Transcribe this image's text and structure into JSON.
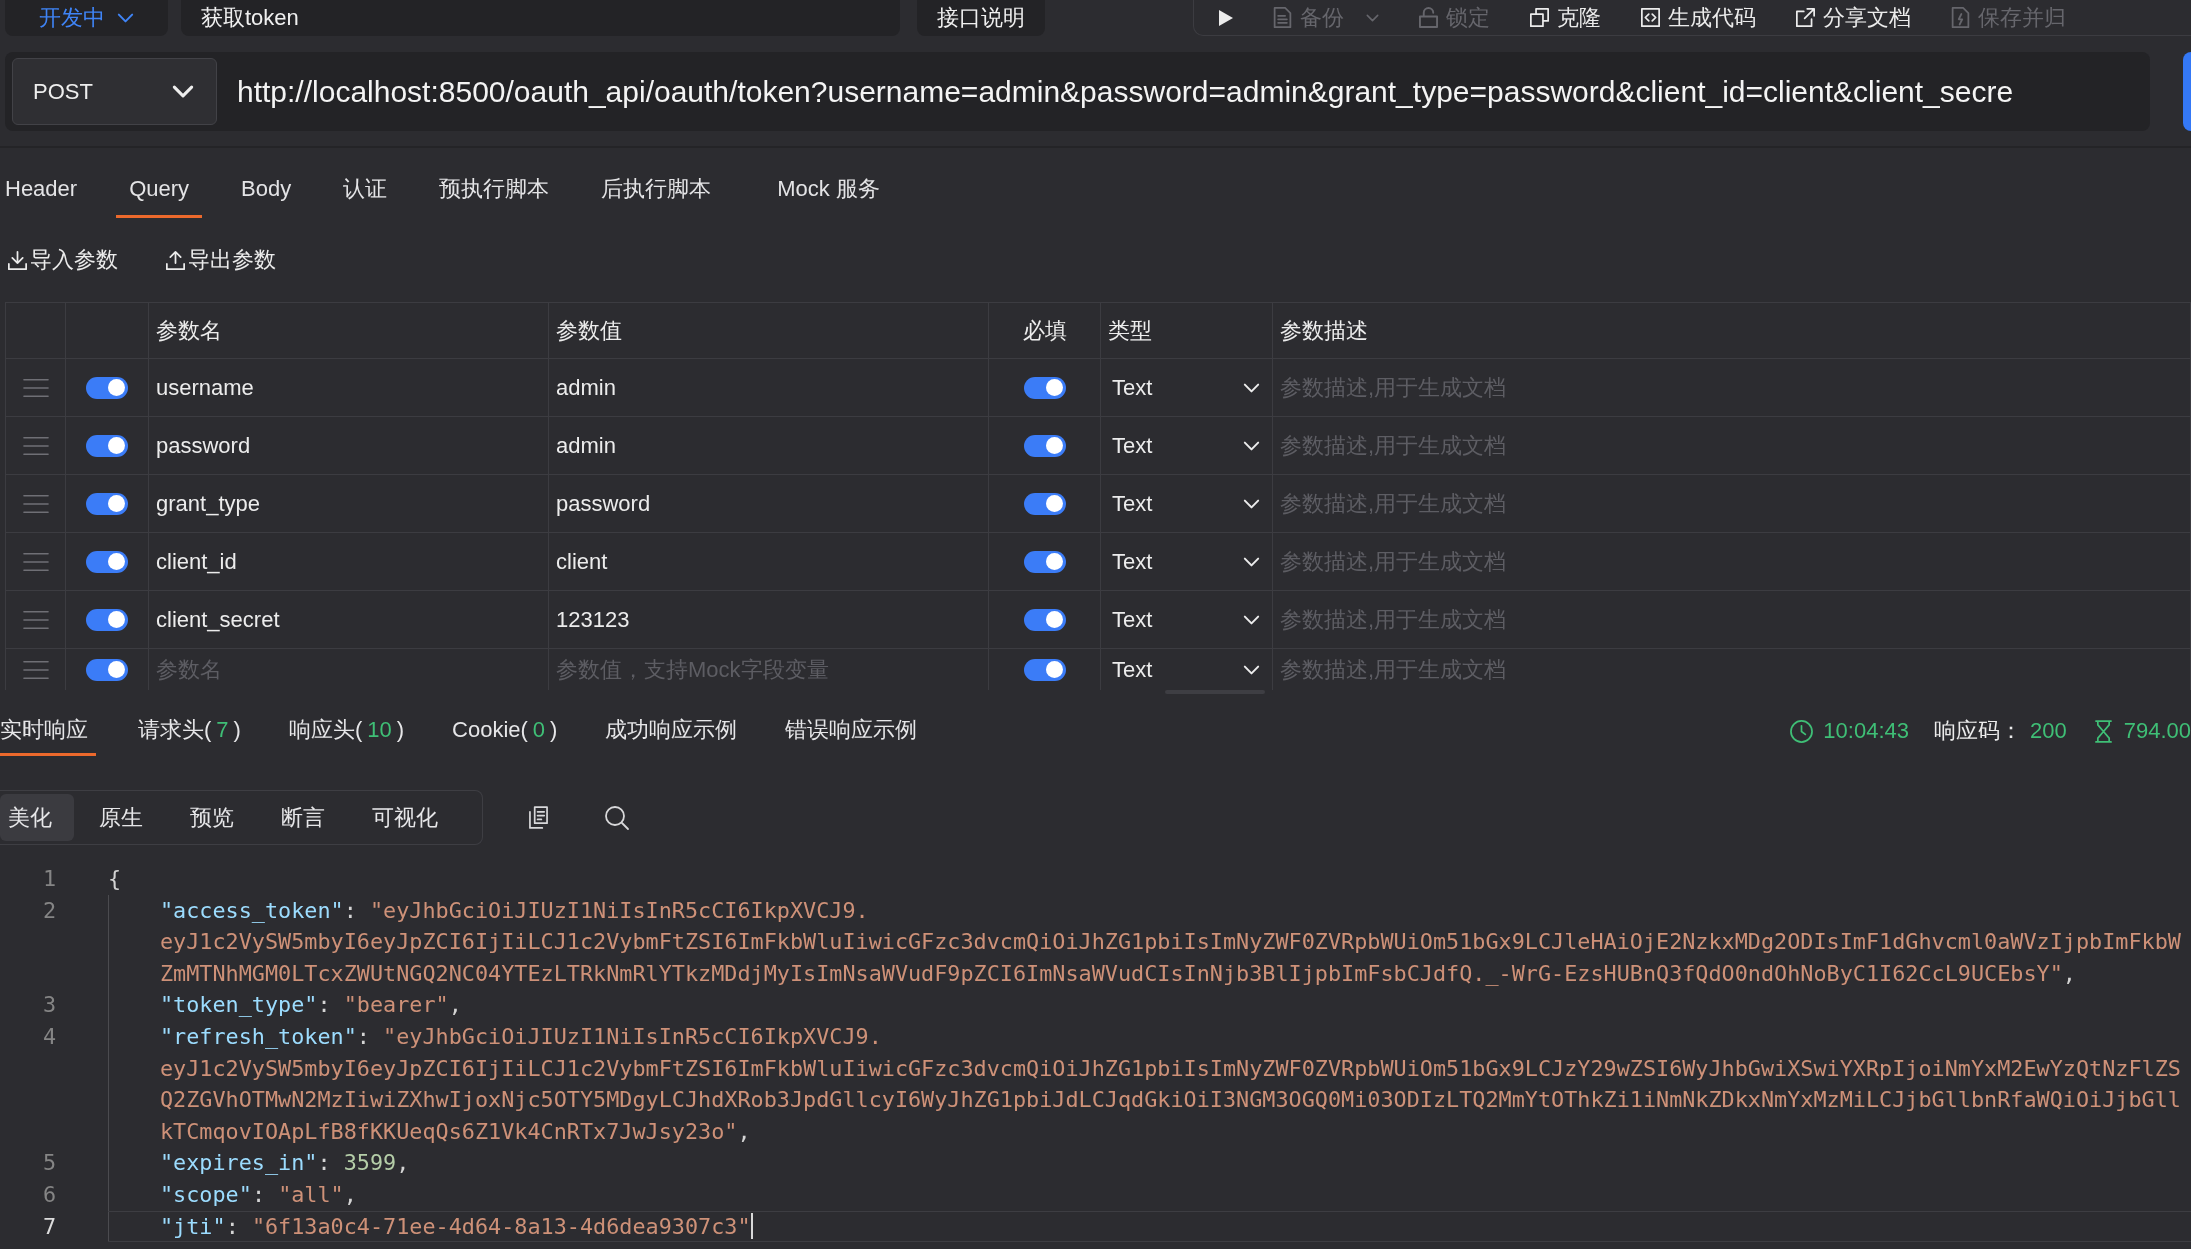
{
  "header": {
    "environment": "开发中",
    "api_name": "获取token",
    "doc_button": "接口说明",
    "toolbar": [
      {
        "kind": "icon",
        "disabled": false,
        "dropdown": false
      },
      {
        "kind": "text",
        "label": "备份",
        "disabled": true,
        "dropdown": true
      },
      {
        "kind": "text",
        "label": "锁定",
        "disabled": true,
        "dropdown": false
      },
      {
        "kind": "text",
        "label": "克隆",
        "disabled": false,
        "dropdown": false
      },
      {
        "kind": "text",
        "label": "生成代码",
        "disabled": false,
        "dropdown": false
      },
      {
        "kind": "text",
        "label": "分享文档",
        "disabled": false,
        "dropdown": false
      },
      {
        "kind": "text",
        "label": "保存并归",
        "disabled": true,
        "dropdown": false
      }
    ]
  },
  "request": {
    "method": "POST",
    "url": "http://localhost:8500/oauth_api/oauth/token?username=admin&password=admin&grant_type=password&client_id=client&client_secre"
  },
  "tabs": [
    {
      "label": "Header",
      "selected": false
    },
    {
      "label": "Query",
      "selected": true
    },
    {
      "label": "Body",
      "selected": false
    },
    {
      "label": "认证",
      "selected": false
    },
    {
      "label": "预执行脚本",
      "selected": false
    },
    {
      "label": "后执行脚本",
      "selected": false
    },
    {
      "label": "Mock 服务",
      "selected": false
    }
  ],
  "param_actions": [
    "导入参数",
    "导出参数"
  ],
  "params_table": {
    "columns": [
      "参数名",
      "参数值",
      "必填",
      "类型",
      "参数描述"
    ],
    "rows": [
      {
        "enabled": true,
        "name": {
          "text": "username"
        },
        "value": {
          "text": "admin"
        },
        "required": true,
        "type": "Text",
        "description": {
          "placeholder": "参数描述,用于生成文档"
        }
      },
      {
        "enabled": true,
        "name": {
          "text": "password"
        },
        "value": {
          "text": "admin"
        },
        "required": true,
        "type": "Text",
        "description": {
          "placeholder": "参数描述,用于生成文档"
        }
      },
      {
        "enabled": true,
        "name": {
          "text": "grant_type"
        },
        "value": {
          "text": "password"
        },
        "required": true,
        "type": "Text",
        "description": {
          "placeholder": "参数描述,用于生成文档"
        }
      },
      {
        "enabled": true,
        "name": {
          "text": "client_id"
        },
        "value": {
          "text": "client"
        },
        "required": true,
        "type": "Text",
        "description": {
          "placeholder": "参数描述,用于生成文档"
        }
      },
      {
        "enabled": true,
        "name": {
          "text": "client_secret"
        },
        "value": {
          "text": "123123"
        },
        "required": true,
        "type": "Text",
        "description": {
          "placeholder": "参数描述,用于生成文档"
        }
      },
      {
        "enabled": true,
        "name": {
          "placeholder": "参数名"
        },
        "value": {
          "placeholder": "参数值，支持Mock字段变量"
        },
        "required": true,
        "type": "Text",
        "description": {
          "placeholder": "参数描述,用于生成文档"
        }
      }
    ]
  },
  "response": {
    "tabs": [
      {
        "label": "实时响应",
        "selected": true
      },
      {
        "label": "请求头(",
        "count": "7",
        "label_end": ")",
        "selected": false
      },
      {
        "label": "响应头(",
        "count": "10",
        "label_end": ")",
        "selected": false
      },
      {
        "label": "Cookie(",
        "count": "0",
        "label_end": ")",
        "selected": false
      },
      {
        "label": "成功响应示例",
        "selected": false
      },
      {
        "label": "错误响应示例",
        "selected": false
      }
    ],
    "time": "10:04:43",
    "code_label": "响应码：",
    "code": "200",
    "duration": "794.00",
    "view_modes": [
      {
        "label": "美化",
        "selected": true
      },
      {
        "label": "原生",
        "selected": false
      },
      {
        "label": "预览",
        "selected": false
      },
      {
        "label": "断言",
        "selected": false
      },
      {
        "label": "可视化",
        "selected": false
      }
    ]
  },
  "code_editor": {
    "lines": [
      {
        "number": "1",
        "current": false,
        "wrapped_lines": [
          {
            "tokens": [
              {
                "kind": "punct",
                "text": "{"
              }
            ]
          }
        ],
        "children": [
          {
            "number": "2",
            "current": false,
            "wrapped_lines": [
              {
                "tokens": [
                  {
                    "kind": "key",
                    "text": "\"access_token\""
                  },
                  {
                    "kind": "punct",
                    "text": ": "
                  },
                  {
                    "kind": "string",
                    "text": "\"eyJhbGciOiJIUzI1NiIsInR5cCI6IkpXVCJ9."
                  }
                ]
              },
              {
                "tokens": [
                  {
                    "kind": "string",
                    "text": "eyJ1c2VySW5mbyI6eyJpZCI6IjIiLCJ1c2VybmFtZSI6ImFkbWluIiwicGFzc3dvcmQiOiJhZG1pbiIsImNyZWF0ZVRpbWUiOm51bGx9LCJleHAiOjE2NzkxMDg2ODIsImF1dGhvcml0aWVzIjpbImFkbW"
                  }
                ]
              },
              {
                "tokens": [
                  {
                    "kind": "string",
                    "text": "ZmMTNhMGM0LTcxZWUtNGQ2NC04YTEzLTRkNmRlYTkzMDdjMyIsImNsaWVudF9pZCI6ImNsaWVudCIsInNjb3BlIjpbImFsbCJdfQ._-WrG-EzsHUBnQ3fQdO0ndOhNoByC1I62CcL9UCEbsY\""
                  },
                  {
                    "kind": "punct",
                    "text": ","
                  }
                ]
              }
            ]
          },
          {
            "number": "3",
            "current": false,
            "wrapped_lines": [
              {
                "tokens": [
                  {
                    "kind": "key",
                    "text": "\"token_type\""
                  },
                  {
                    "kind": "punct",
                    "text": ": "
                  },
                  {
                    "kind": "string",
                    "text": "\"bearer\""
                  },
                  {
                    "kind": "punct",
                    "text": ","
                  }
                ]
              }
            ]
          },
          {
            "number": "4",
            "current": false,
            "wrapped_lines": [
              {
                "tokens": [
                  {
                    "kind": "key",
                    "text": "\"refresh_token\""
                  },
                  {
                    "kind": "punct",
                    "text": ": "
                  },
                  {
                    "kind": "string",
                    "text": "\"eyJhbGciOiJIUzI1NiIsInR5cCI6IkpXVCJ9."
                  }
                ]
              },
              {
                "tokens": [
                  {
                    "kind": "string",
                    "text": "eyJ1c2VySW5mbyI6eyJpZCI6IjIiLCJ1c2VybmFtZSI6ImFkbWluIiwicGFzc3dvcmQiOiJhZG1pbiIsImNyZWF0ZVRpbWUiOm51bGx9LCJzY29wZSI6WyJhbGwiXSwiYXRpIjoiNmYxM2EwYzQtNzFlZS"
                  }
                ]
              },
              {
                "tokens": [
                  {
                    "kind": "string",
                    "text": "Q2ZGVhOTMwN2MzIiwiZXhwIjoxNjc5OTY5MDgyLCJhdXRob3JpdGllcyI6WyJhZG1pbiJdLCJqdGkiOiI3NGM3OGQ0Mi03ODIzLTQ2MmYtOThkZi1iNmNkZDkxNmYxMzMiLCJjbGllbnRfaWQiOiJjbGll"
                  }
                ]
              },
              {
                "tokens": [
                  {
                    "kind": "string",
                    "text": "kTCmqovIOApLfB8fKKUeqQs6Z1Vk4CnRTx7JwJsy23o\""
                  },
                  {
                    "kind": "punct",
                    "text": ","
                  }
                ]
              }
            ]
          },
          {
            "number": "5",
            "current": false,
            "wrapped_lines": [
              {
                "tokens": [
                  {
                    "kind": "key",
                    "text": "\"expires_in\""
                  },
                  {
                    "kind": "punct",
                    "text": ": "
                  },
                  {
                    "kind": "number",
                    "text": "3599"
                  },
                  {
                    "kind": "punct",
                    "text": ","
                  }
                ]
              }
            ]
          },
          {
            "number": "6",
            "current": false,
            "wrapped_lines": [
              {
                "tokens": [
                  {
                    "kind": "key",
                    "text": "\"scope\""
                  },
                  {
                    "kind": "punct",
                    "text": ": "
                  },
                  {
                    "kind": "string",
                    "text": "\"all\""
                  },
                  {
                    "kind": "punct",
                    "text": ","
                  }
                ]
              }
            ]
          },
          {
            "number": "7",
            "current": true,
            "wrapped_lines": [
              {
                "tokens": [
                  {
                    "kind": "key",
                    "text": "\"jti\""
                  },
                  {
                    "kind": "punct",
                    "text": ": "
                  },
                  {
                    "kind": "string",
                    "text": "\"6f13a0c4-71ee-4d64-8a13-4d6dea9307c3\""
                  }
                ]
              }
            ]
          }
        ]
      }
    ]
  }
}
